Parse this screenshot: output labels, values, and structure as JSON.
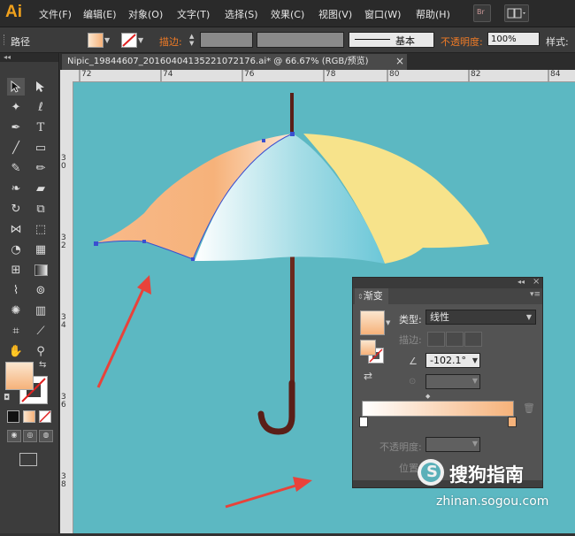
{
  "app": {
    "logo": "Ai"
  },
  "menu": [
    "文件(F)",
    "编辑(E)",
    "对象(O)",
    "文字(T)",
    "选择(S)",
    "效果(C)",
    "视图(V)",
    "窗口(W)",
    "帮助(H)"
  ],
  "menu_icons": [
    "bridge-icon",
    "arrange-documents-icon"
  ],
  "menu_icon_text": {
    "bridge": "Br"
  },
  "control": {
    "label": "路径",
    "stroke_label": "描边:",
    "stroke_style": "基本",
    "opacity_label": "不透明度:",
    "opacity_value": "100%",
    "style_label": "样式:"
  },
  "document": {
    "tab_title": "Nipic_19844607_20160404135221072176.ai* @ 66.67% (RGB/预览)",
    "close": "×"
  },
  "rulers": {
    "horizontal": [
      "72",
      "74",
      "76",
      "78",
      "80",
      "82",
      "84"
    ],
    "vertical": [
      "3 0",
      "3 2",
      "3 4",
      "3 6",
      "3 8"
    ]
  },
  "gradient_panel": {
    "title": "渐变",
    "type_label": "类型:",
    "type_value": "线性",
    "stroke_label": "描边:",
    "angle_value": "-102.1°",
    "opacity_label": "不透明度:",
    "position_label": "位置:"
  },
  "colors": {
    "canvas": "#5cb8c2",
    "umbrella_orange": "#f6b27a",
    "umbrella_blue": "#6cc7d8",
    "umbrella_yellow": "#f7e38b",
    "handle": "#5a1f18",
    "annotation_arrow": "#e8423a"
  },
  "watermark": {
    "text": "搜狗指南",
    "url": "zhinan.sogou.com"
  }
}
